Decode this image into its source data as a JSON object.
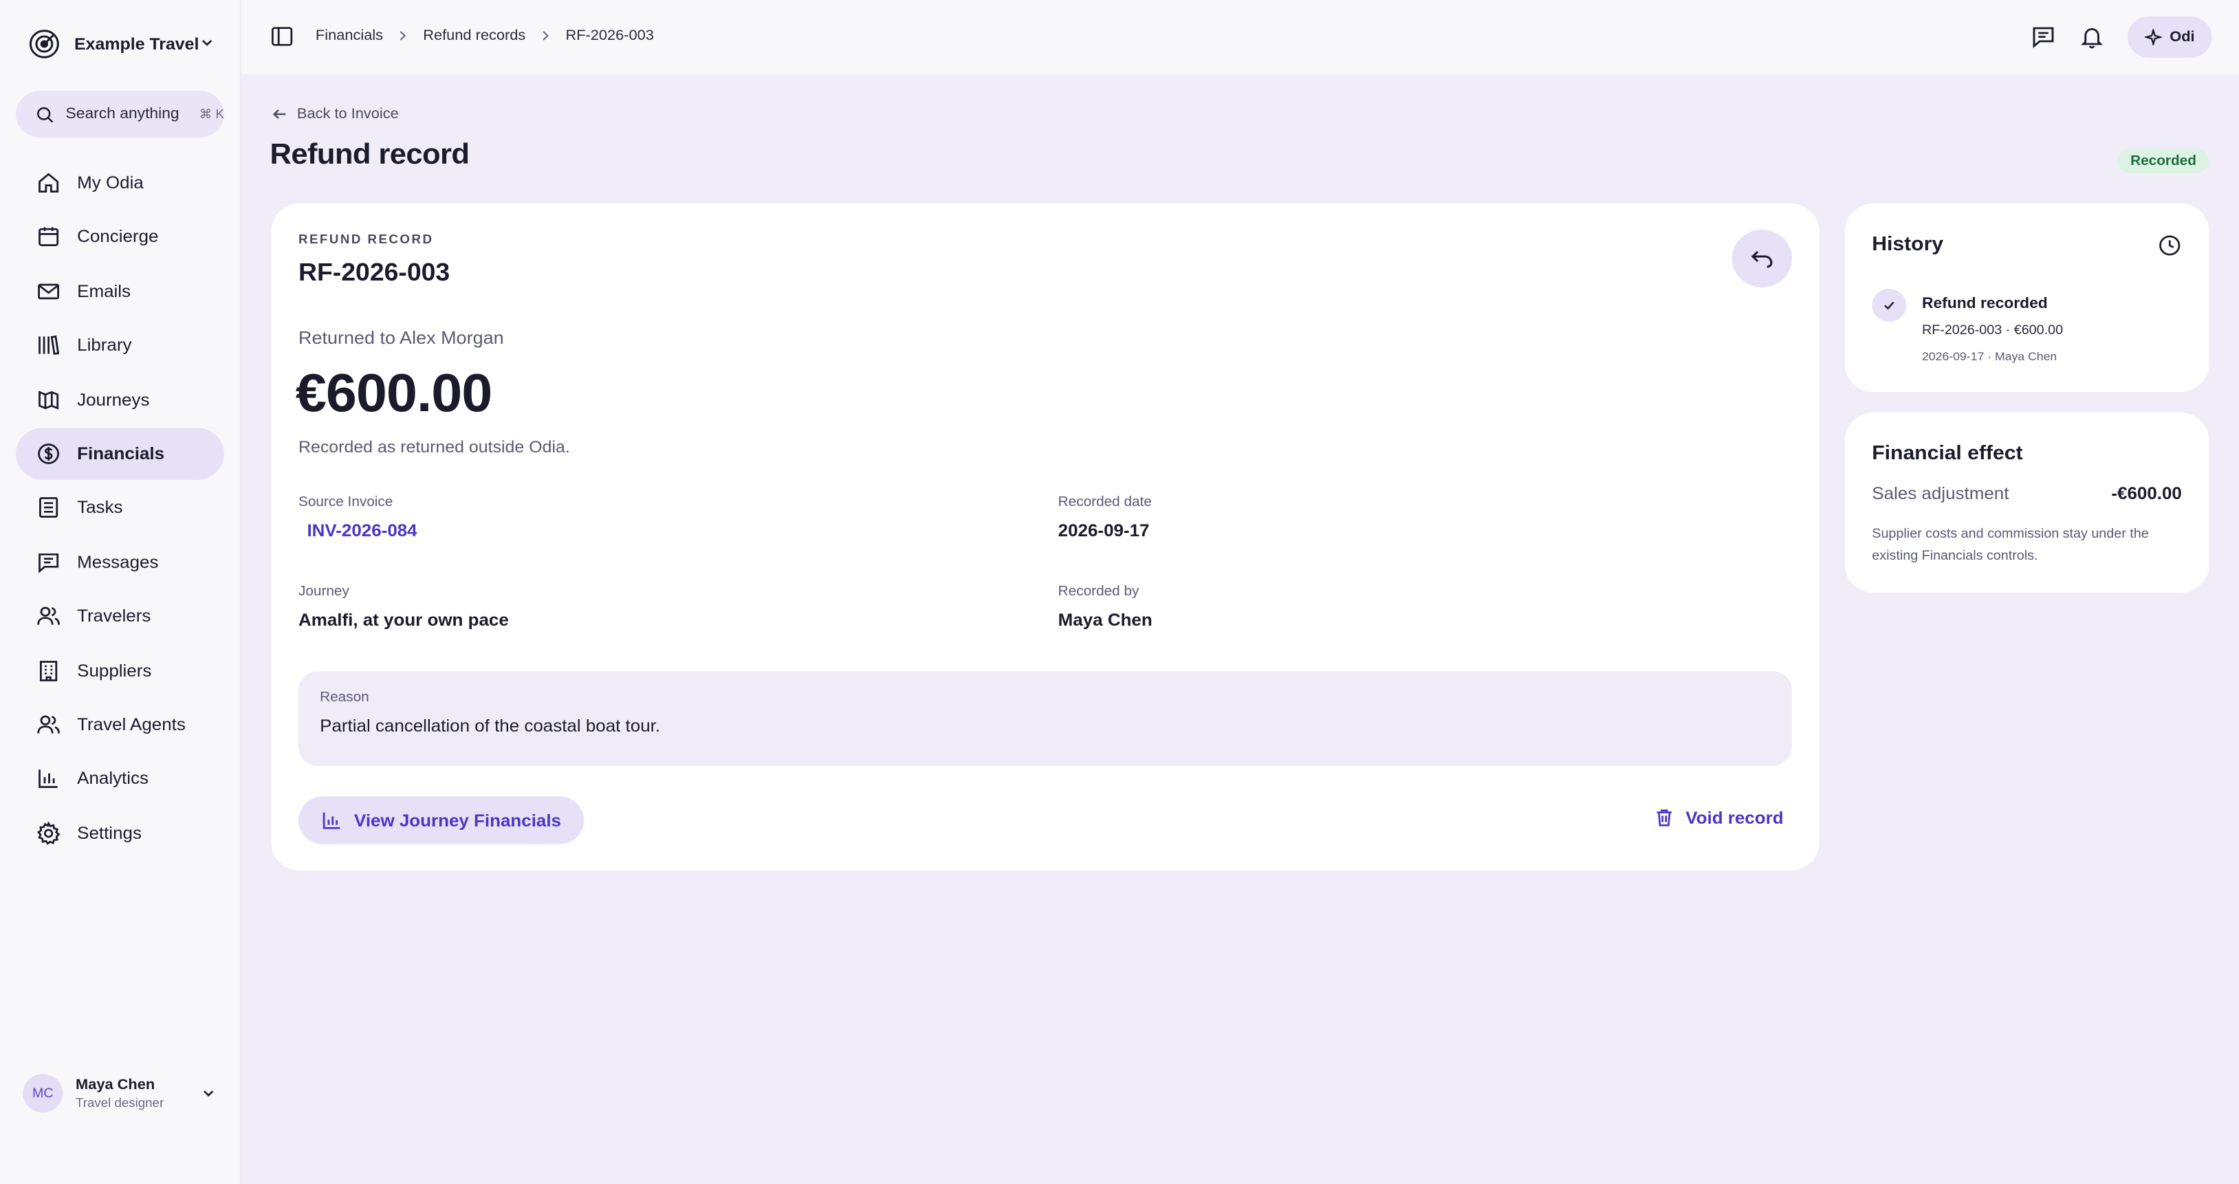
{
  "sidebar": {
    "brand": "Example Travel",
    "search": {
      "label": "Search anything",
      "shortcut": "⌘ K"
    },
    "items": [
      {
        "label": "My Odia",
        "icon": "home-icon"
      },
      {
        "label": "Concierge",
        "icon": "calendar-icon"
      },
      {
        "label": "Emails",
        "icon": "mail-icon"
      },
      {
        "label": "Library",
        "icon": "library-icon"
      },
      {
        "label": "Journeys",
        "icon": "map-icon"
      },
      {
        "label": "Financials",
        "icon": "dollar-circle-icon",
        "active": true
      },
      {
        "label": "Tasks",
        "icon": "tasks-icon"
      },
      {
        "label": "Messages",
        "icon": "message-icon"
      },
      {
        "label": "Travelers",
        "icon": "users-icon"
      },
      {
        "label": "Suppliers",
        "icon": "building-icon"
      },
      {
        "label": "Travel Agents",
        "icon": "users-icon"
      },
      {
        "label": "Analytics",
        "icon": "bar-chart-icon"
      },
      {
        "label": "Settings",
        "icon": "gear-icon"
      }
    ],
    "user": {
      "initials": "MC",
      "name": "Maya Chen",
      "role": "Travel designer"
    }
  },
  "header": {
    "breadcrumbs": [
      "Financials",
      "Refund records",
      "RF-2026-003"
    ],
    "assistant_label": "Odi"
  },
  "page": {
    "back_label": "Back to Invoice",
    "title": "Refund record",
    "status": "Recorded"
  },
  "record": {
    "eyebrow": "REFUND RECORD",
    "id": "RF-2026-003",
    "returned_to": "Returned to Alex Morgan",
    "amount": "€600.00",
    "amount_note": "Recorded as returned outside Odia.",
    "fields": {
      "source_invoice_label": "Source Invoice",
      "source_invoice": "INV-2026-084",
      "recorded_date_label": "Recorded date",
      "recorded_date": "2026-09-17",
      "journey_label": "Journey",
      "journey": "Amalfi, at your own pace",
      "recorded_by_label": "Recorded by",
      "recorded_by": "Maya Chen"
    },
    "reason_label": "Reason",
    "reason": "Partial cancellation of the coastal boat tour.",
    "view_button": "View Journey Financials",
    "void_button": "Void record"
  },
  "history": {
    "title": "History",
    "entries": [
      {
        "title": "Refund recorded",
        "detail": "RF-2026-003 · €600.00",
        "meta": "2026-09-17 · Maya Chen"
      }
    ]
  },
  "effect": {
    "title": "Financial effect",
    "label": "Sales adjustment",
    "value": "-€600.00",
    "note": "Supplier costs and commission stay under the existing Financials controls."
  },
  "colors": {
    "accent": "#4b35c6",
    "accent_soft": "#e6e1f6",
    "background": "#f0edf8",
    "status_green": "#1f6b3d"
  }
}
